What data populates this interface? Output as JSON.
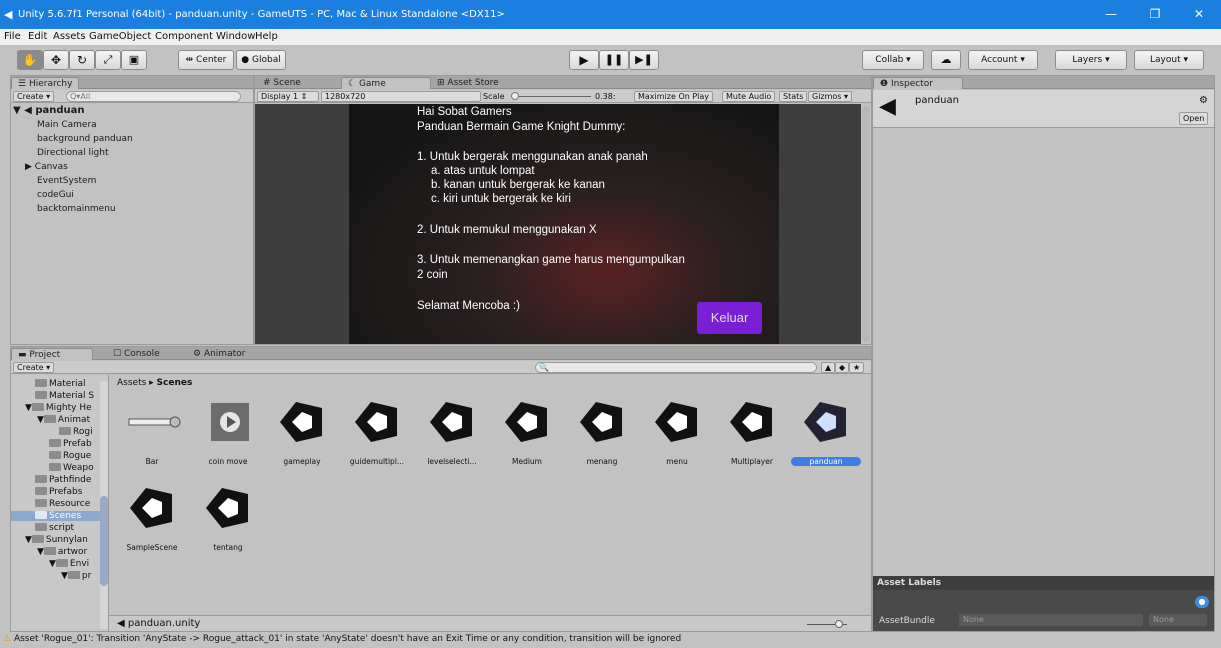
{
  "window": {
    "title": "Unity 5.6.7f1 Personal (64bit) - panduan.unity - GameUTS - PC, Mac & Linux Standalone <DX11>",
    "controls": {
      "minimize": "—",
      "restore": "❐",
      "close": "✕"
    }
  },
  "menu": [
    "File",
    "Edit",
    "Assets",
    "GameObject",
    "Component",
    "Window",
    "Help"
  ],
  "toolbar": {
    "pivot": "Center",
    "space": "Global",
    "collab": "Collab ▾",
    "account": "Account",
    "layers": "Layers",
    "layout": "Layout"
  },
  "hierarchy": {
    "tab": "Hierarchy",
    "create": "Create",
    "search_placeholder": "Q▾All",
    "scene": "panduan",
    "items": [
      "Main Camera",
      "background panduan",
      "Directional light",
      "Canvas",
      "EventSystem",
      "codeGui",
      "backtomainmenu"
    ]
  },
  "center_tabs": {
    "scene": "Scene",
    "game": "Game",
    "store": "Asset Store"
  },
  "game_bar": {
    "display": "Display 1",
    "resolution": "1280x720",
    "scale_label": "Scale",
    "scale_value": "0.38:",
    "maximize": "Maximize On Play",
    "mute": "Mute Audio",
    "stats": "Stats",
    "gizmos": "Gizmos"
  },
  "game_view": {
    "lines": [
      "Hai Sobat Gamers",
      "Panduan Bermain Game Knight Dummy:",
      "1. Untuk bergerak menggunakan anak panah",
      "a. atas untuk lompat",
      "b. kanan untuk bergerak ke kanan",
      "c. kiri untuk bergerak ke kiri",
      "2. Untuk memukul menggunakan X",
      "3. Untuk memenangkan game harus mengumpulkan",
      "2 coin",
      "Selamat Mencoba :)"
    ],
    "button": "Keluar",
    "button_color": "#7b1fd6"
  },
  "inspector": {
    "tab": "Inspector",
    "object": "panduan",
    "open": "Open",
    "asset_labels": "Asset Labels",
    "asset_bundle": "AssetBundle",
    "none1": "None",
    "none2": "None"
  },
  "project": {
    "tabs": {
      "project": "Project",
      "console": "Console",
      "animator": "Animator"
    },
    "create": "Create",
    "breadcrumb_root": "Assets",
    "breadcrumb_current": "Scenes",
    "folders": [
      "Material",
      "Material S",
      "Mighty He",
      "Animat",
      "Rogi",
      "Prefab",
      "Rogue",
      "Weapo",
      "Pathfinde",
      "Prefabs",
      "Resource",
      "Scenes",
      "script",
      "Sunnylan",
      "artwor",
      "Envi",
      "pr"
    ],
    "assets": [
      "Bar",
      "coin move",
      "gameplay",
      "guidemultipl...",
      "levelselecti...",
      "Medium",
      "menang",
      "menu",
      "Multiplayer",
      "panduan",
      "SampleScene",
      "tentang"
    ],
    "footer_file": "panduan.unity"
  },
  "status": {
    "message": "Asset 'Rogue_01': Transition 'AnyState -> Rogue_attack_01' in state 'AnyState' doesn't have an Exit Time or any condition, transition will be ignored"
  },
  "colors": {
    "titlebar": "#1b7fe0",
    "selection": "#3d7ee6",
    "game_bg": "#2a2a2a"
  }
}
